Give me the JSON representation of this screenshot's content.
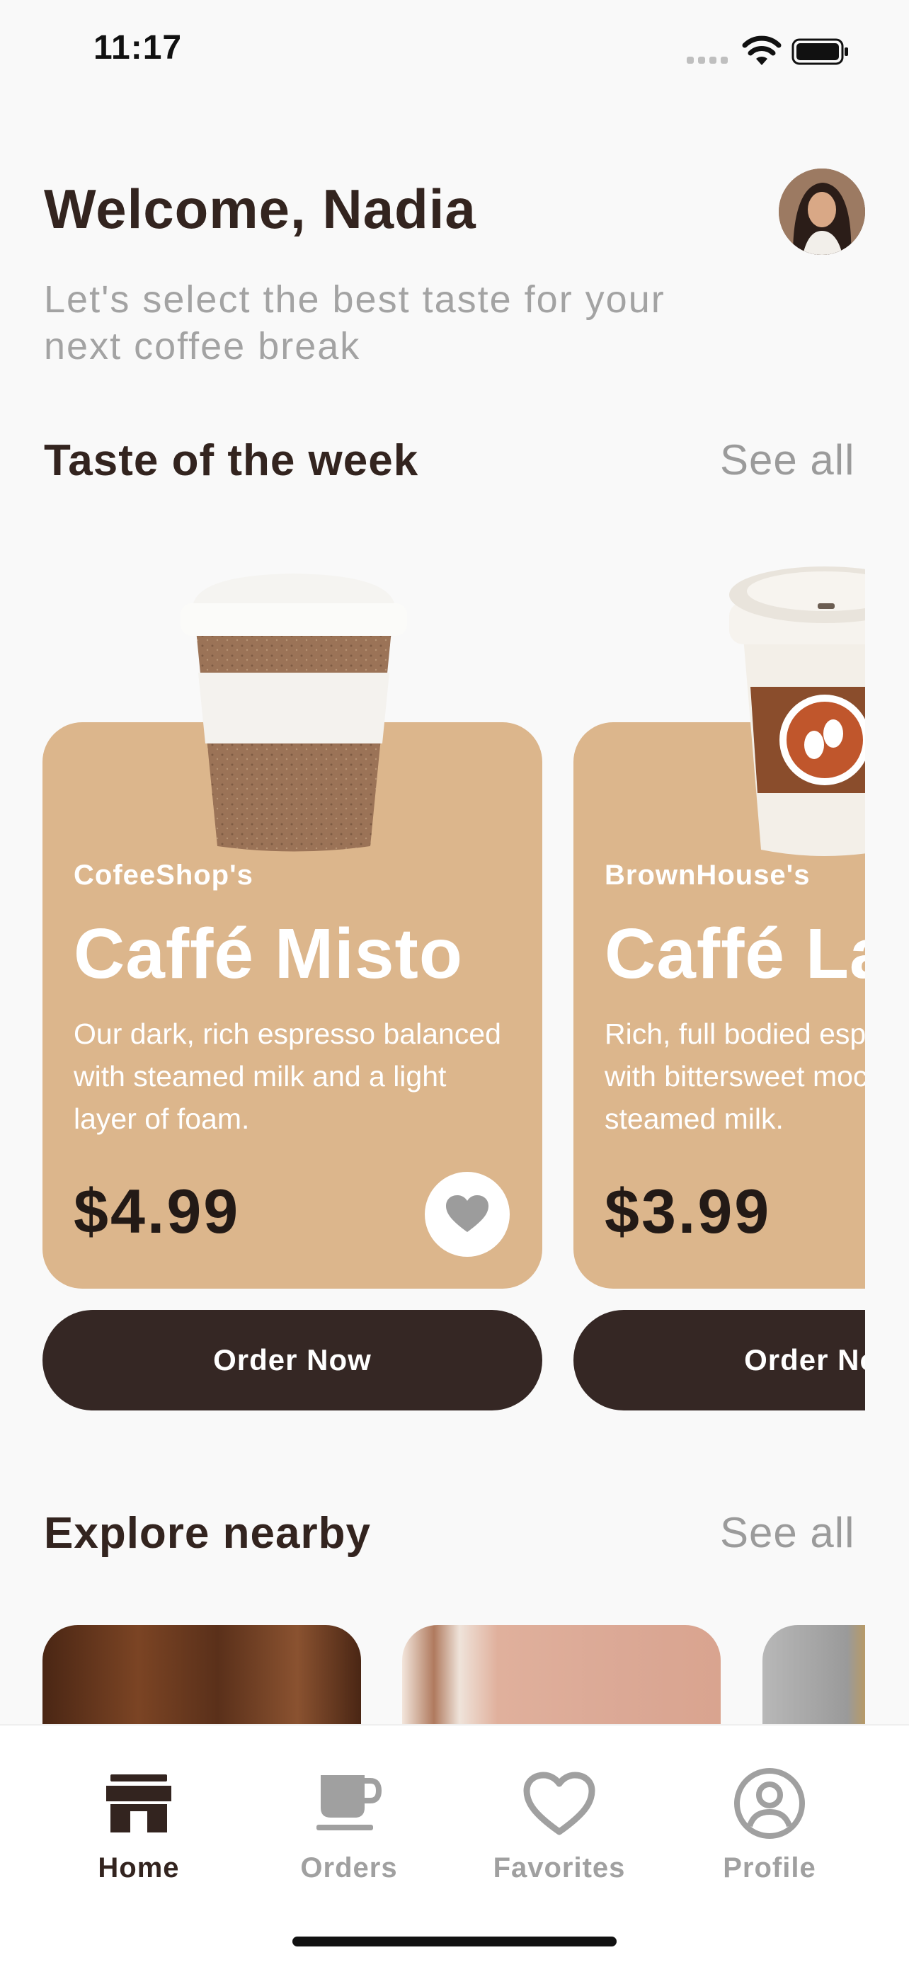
{
  "status_bar": {
    "time": "11:17"
  },
  "header": {
    "welcome": "Welcome, Nadia",
    "subtitle": "Let's select the best taste for your next coffee break"
  },
  "taste_section": {
    "title": "Taste of the week",
    "see_all": "See all"
  },
  "products": [
    {
      "shop": "CofeeShop's",
      "name": "Caffé Misto",
      "description": "Our dark, rich espresso balanced with steamed milk and a light layer of foam.",
      "price": "$4.99",
      "order_label": "Order Now"
    },
    {
      "shop": "BrownHouse's",
      "name": "Caffé Latte",
      "description": "Rich, full bodied espresso filled with bittersweet mocha sauce and steamed milk.",
      "price": "$3.99",
      "order_label": "Order Now"
    }
  ],
  "explore_section": {
    "title": "Explore nearby",
    "see_all": "See all"
  },
  "tab_bar": {
    "items": [
      {
        "label": "Home",
        "icon": "store-icon",
        "active": true
      },
      {
        "label": "Orders",
        "icon": "cup-icon",
        "active": false
      },
      {
        "label": "Favorites",
        "icon": "heart-icon",
        "active": false
      },
      {
        "label": "Profile",
        "icon": "person-circle-icon",
        "active": false
      }
    ]
  },
  "colors": {
    "background": "#f9f9f9",
    "card": "#dcb68c",
    "dark_brown": "#352724",
    "muted_text": "#a3a3a3"
  }
}
